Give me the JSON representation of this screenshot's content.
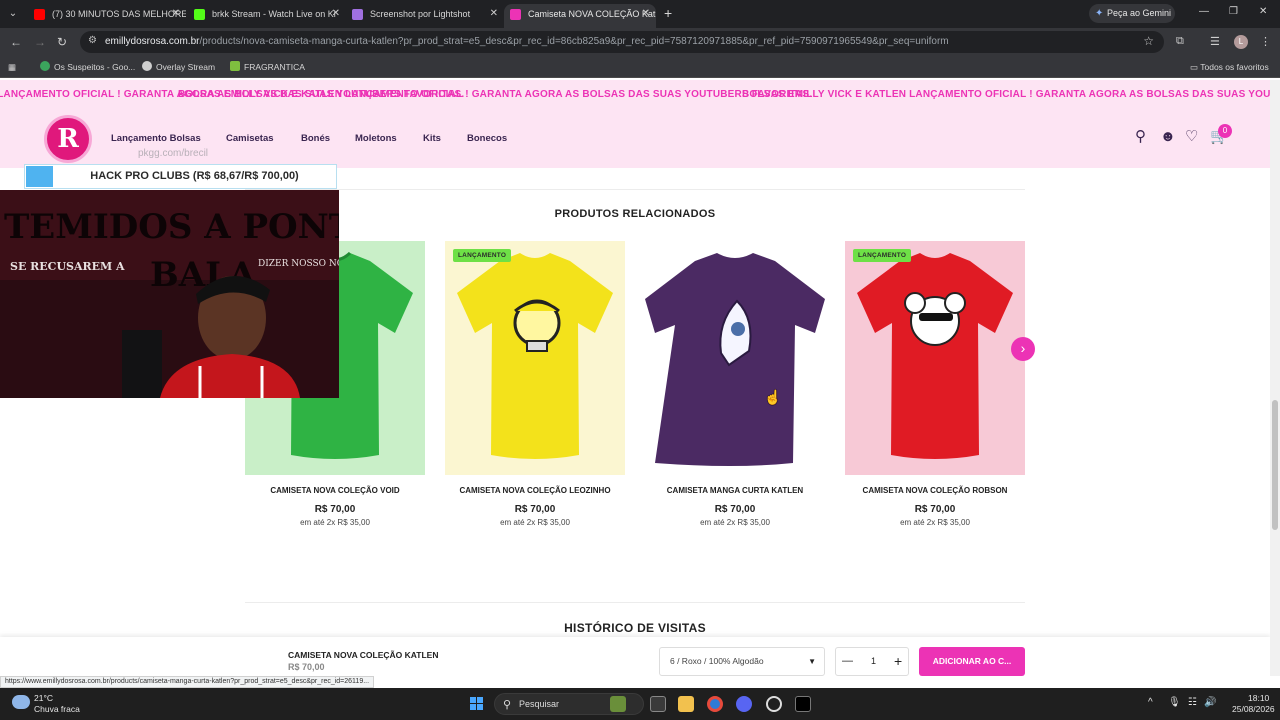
{
  "browser": {
    "tabs": [
      {
        "title": "(7) 30 MINUTOS DAS MELHORE",
        "color": "#ff0000"
      },
      {
        "title": "brkk Stream - Watch Live on Ki",
        "color": "#53fc18"
      },
      {
        "title": "Screenshot por Lightshot",
        "color": "#a070e0"
      },
      {
        "title": "Camiseta NOVA COLEÇÃO Katle",
        "color": "#ec33b5"
      }
    ],
    "gemini_label": "Peça ao Gemini",
    "url_host": "emillydosrosa.com.br",
    "url_path": "/products/nova-camiseta-manga-curta-katlen?pr_prod_strat=e5_desc&pr_rec_id=86cb825a9&pr_rec_pid=7587120971885&pr_ref_pid=7590971965549&pr_seq=uniform",
    "profile_initial": "L",
    "bookmarks": [
      "Os Suspeitos - Goo...",
      "Overlay Stream",
      "FRAGRANTICA"
    ],
    "all_bookmarks": "Todos os favoritos"
  },
  "site": {
    "marquee": "BOLSAS EMILLY VICK E KATLEN LANÇAMENTO OFICIAL ! GARANTA AGORA AS BOLSAS DAS SUAS YOUTUBERS FAVORITAS.",
    "marquee_partial": "AS SUAS YOUTUBERS FAVORITAS.",
    "marquee_tail": "BOLSAS EMILLY VICK E KATLEN LANÇAMENTO OFICIAL ! GARANTA AGORA AS BOLSAS DAS SUAS YOUTUBERS FAVORIT",
    "nav": [
      "Lançamento Bolsas",
      "Camisetas",
      "Bonés",
      "Moletons",
      "Kits",
      "Bonecos"
    ],
    "cart_count": "0",
    "related_title": "PRODUTOS RELACIONADOS",
    "history_title": "HISTÓRICO DE VISITAS",
    "products": [
      {
        "name": "CAMISETA NOVA COLEÇÃO VOID",
        "price": "R$ 70,00",
        "installments": "em até 2x R$ 35,00",
        "badge": "",
        "shirt": "#2fb344",
        "bg": "#c9efc8"
      },
      {
        "name": "CAMISETA NOVA COLEÇÃO LEOZINHO",
        "price": "R$ 70,00",
        "installments": "em até 2x R$ 35,00",
        "badge": "LANÇAMENTO",
        "shirt": "#f3e21b",
        "bg": "#fbf6d1"
      },
      {
        "name": "CAMISETA MANGA CURTA KATLEN",
        "price": "R$ 70,00",
        "installments": "em até 2x R$ 35,00",
        "badge": "",
        "shirt": "#4b2a63",
        "bg": "#ffffff"
      },
      {
        "name": "CAMISETA NOVA COLEÇÃO ROBSON",
        "price": "R$ 70,00",
        "installments": "em até 2x R$ 35,00",
        "badge": "LANÇAMENTO",
        "shirt": "#e01b24",
        "bg": "#f7c9d6"
      }
    ],
    "sticky": {
      "name": "CAMISETA NOVA COLEÇÃO KATLEN",
      "price": "R$ 70,00",
      "variant": "6 / Roxo / 100% Algodão",
      "qty": "1",
      "add_label": "ADICIONAR AO C..."
    },
    "status_url": "https://www.emillydosrosa.com.br/products/camiseta-manga-curta-katlen?pr_prod_strat=e5_desc&pr_rec_id=26119..."
  },
  "overlay": {
    "promo": "HACK PRO CLUBS (R$ 68,67/R$ 700,00)",
    "watermark": "pkgg.com/brecil",
    "banner_line1": "TEMIDOS A PONTO DE LES",
    "banner_line2": "SE RECUSAREM A",
    "banner_line3": "BALA",
    "banner_line4": "DIZER NOSSO NOME"
  },
  "taskbar": {
    "temp": "21°C",
    "weather": "Chuva fraca",
    "search": "Pesquisar",
    "time": "18:10",
    "date": "25/08/2026"
  },
  "colors": {
    "accent": "#ec33b5",
    "header_bg": "#fde4f3",
    "nav_text": "#3a2550"
  }
}
